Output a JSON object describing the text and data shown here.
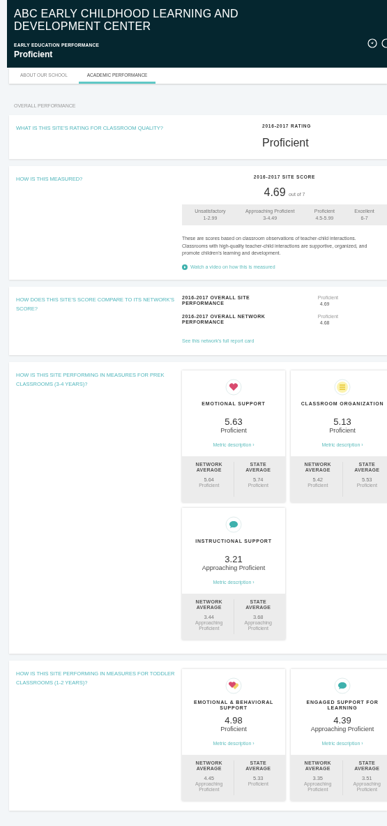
{
  "header": {
    "title": "ABC EARLY CHILDHOOD LEARNING AND DEVELOPMENT CENTER",
    "subtitle": "EARLY EDUCATION PERFORMANCE",
    "rating": "Proficient"
  },
  "tabs": [
    {
      "label": "ABOUT OUR SCHOOL",
      "selected": false
    },
    {
      "label": "ACADEMIC PERFORMANCE",
      "selected": true
    }
  ],
  "section_label": "OVERALL PERFORMANCE",
  "rating_card": {
    "question": "WHAT IS THIS SITE'S RATING FOR CLASSROOM QUALITY?",
    "heading": "2016-2017 RATING",
    "value": "Proficient"
  },
  "score_card": {
    "question": "HOW IS THIS MEASURED?",
    "heading": "2016-2017 SITE SCORE",
    "score": "4.69",
    "out_of": "out of 7",
    "scale": [
      {
        "name": "Unsatisfactory",
        "range": "1-2.99"
      },
      {
        "name": "Approaching Proficient",
        "range": "3-4.49"
      },
      {
        "name": "Proficient",
        "range": "4.5-5.99"
      },
      {
        "name": "Excellent",
        "range": "6-7"
      }
    ],
    "description": "These are scores based on classroom observations of teacher-child interactions. Classrooms with high-quality teacher-child interactions are supportive, organized, and promote children's learning and development.",
    "video_link": "Watch a video on how this is measured"
  },
  "compare_card": {
    "question": "HOW DOES THIS SITE'S SCORE COMPARE TO ITS NETWORK'S SCORE?",
    "rows": [
      {
        "label": "2016-2017 OVERALL SITE PERFORMANCE",
        "rating": "Proficient",
        "score": "4.69"
      },
      {
        "label": "2016-2017 OVERALL NETWORK PERFORMANCE",
        "rating": "Proficient",
        "score": "4.68"
      }
    ],
    "link": "See this network's full report card"
  },
  "measure_sections": [
    {
      "question": "HOW IS THIS SITE PERFORMING IN MEASURES FOR PREK CLASSROOMS (3-4 YEARS)?",
      "metrics": [
        {
          "kind": "heart",
          "name": "EMOTIONAL SUPPORT",
          "score": "5.63",
          "rating": "Proficient",
          "link": "Metric description ›",
          "averages": [
            {
              "label": "NETWORK AVERAGE",
              "score": "5.64",
              "rating": "Proficient"
            },
            {
              "label": "STATE AVERAGE",
              "score": "5.74",
              "rating": "Proficient"
            }
          ]
        },
        {
          "kind": "list",
          "name": "CLASSROOM ORGANIZATION",
          "score": "5.13",
          "rating": "Proficient",
          "link": "Metric description ›",
          "averages": [
            {
              "label": "NETWORK AVERAGE",
              "score": "5.42",
              "rating": "Proficient"
            },
            {
              "label": "STATE AVERAGE",
              "score": "5.53",
              "rating": "Proficient"
            }
          ]
        },
        {
          "kind": "chat",
          "name": "INSTRUCTIONAL SUPPORT",
          "score": "3.21",
          "rating": "Approaching Proficient",
          "link": "Metric description ›",
          "averages": [
            {
              "label": "NETWORK AVERAGE",
              "score": "3.44",
              "rating": "Approaching Proficient"
            },
            {
              "label": "STATE AVERAGE",
              "score": "3.68",
              "rating": "Approaching Proficient"
            }
          ]
        }
      ]
    },
    {
      "question": "HOW IS THIS SITE PERFORMING IN MEASURES FOR TODDLER CLASSROOMS (1-2 YEARS)?",
      "metrics": [
        {
          "kind": "hearts",
          "name": "EMOTIONAL & BEHAVIORAL SUPPORT",
          "score": "4.98",
          "rating": "Proficient",
          "link": "Metric description ›",
          "averages": [
            {
              "label": "NETWORK AVERAGE",
              "score": "4.45",
              "rating": "Approaching Proficient"
            },
            {
              "label": "STATE AVERAGE",
              "score": "5.33",
              "rating": "Proficient"
            }
          ]
        },
        {
          "kind": "chat",
          "name": "ENGAGED SUPPORT FOR LEARNING",
          "score": "4.39",
          "rating": "Approaching Proficient",
          "link": "Metric description ›",
          "averages": [
            {
              "label": "NETWORK AVERAGE",
              "score": "3.35",
              "rating": "Approaching Proficient"
            },
            {
              "label": "STATE AVERAGE",
              "score": "3.51",
              "rating": "Approaching Proficient"
            }
          ]
        }
      ]
    }
  ]
}
